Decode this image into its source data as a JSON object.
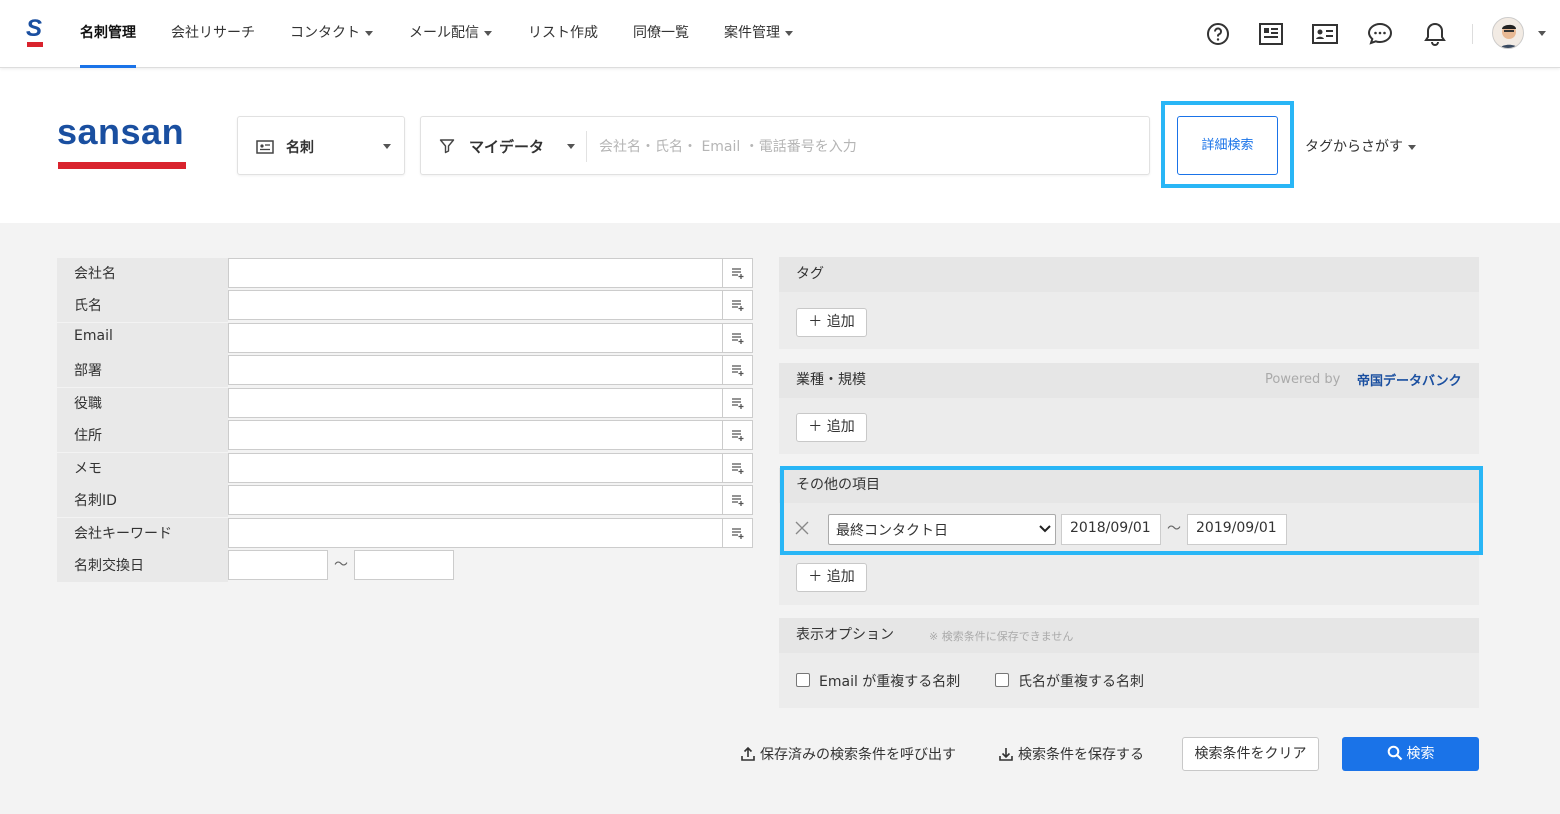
{
  "topnav": {
    "logo_letter": "S",
    "items": [
      {
        "label": "名刺管理",
        "active": true,
        "dropdown": false
      },
      {
        "label": "会社リサーチ",
        "active": false,
        "dropdown": false
      },
      {
        "label": "コンタクト",
        "active": false,
        "dropdown": true
      },
      {
        "label": "メール配信",
        "active": false,
        "dropdown": true
      },
      {
        "label": "リスト作成",
        "active": false,
        "dropdown": false
      },
      {
        "label": "同僚一覧",
        "active": false,
        "dropdown": false
      },
      {
        "label": "案件管理",
        "active": false,
        "dropdown": true
      }
    ],
    "icons": [
      "help-icon",
      "news-icon",
      "card-icon",
      "chat-icon",
      "bell-icon"
    ]
  },
  "brand": {
    "text": "sansan",
    "accent": "#d9232d",
    "primary": "#1a4fa0"
  },
  "searchbar": {
    "type_select": "名刺",
    "scope_select": "マイデータ",
    "placeholder": "会社名・氏名・ Email ・電話番号を入力",
    "detail_button": "詳細検索",
    "tag_search": "タグからさがす"
  },
  "form": {
    "fields": [
      {
        "label": "会社名",
        "value": ""
      },
      {
        "label": "氏名",
        "value": ""
      },
      {
        "label": "Email",
        "value": ""
      },
      {
        "label": "部署",
        "value": ""
      },
      {
        "label": "役職",
        "value": ""
      },
      {
        "label": "住所",
        "value": ""
      },
      {
        "label": "メモ",
        "value": ""
      },
      {
        "label": "名刺ID",
        "value": ""
      },
      {
        "label": "会社キーワード",
        "value": ""
      }
    ],
    "exchange_date_label": "名刺交換日",
    "range_sep": "〜"
  },
  "tag_section": {
    "title": "タグ",
    "add_label": "＋ 追加"
  },
  "industry_section": {
    "title": "業種・規模",
    "powered_by": "Powered by",
    "provider": "帝国データバンク",
    "add_label": "＋ 追加"
  },
  "other_section": {
    "title": "その他の項目",
    "field": "最終コンタクト日",
    "from": "2018/09/01",
    "range_sep": "〜",
    "to": "2019/09/01",
    "add_label": "＋ 追加"
  },
  "display_options": {
    "title": "表示オプション",
    "note": "※ 検索条件に保存できません",
    "options": [
      {
        "label": "Email が重複する名刺",
        "checked": false
      },
      {
        "label": "氏名が重複する名刺",
        "checked": false
      }
    ]
  },
  "actions": {
    "load_saved": "保存済みの検索条件を呼び出す",
    "save": "検索条件を保存する",
    "clear": "検索条件をクリア",
    "search": "検索"
  },
  "colors": {
    "accent_blue": "#1a73e8",
    "highlight": "#29b6f6"
  }
}
